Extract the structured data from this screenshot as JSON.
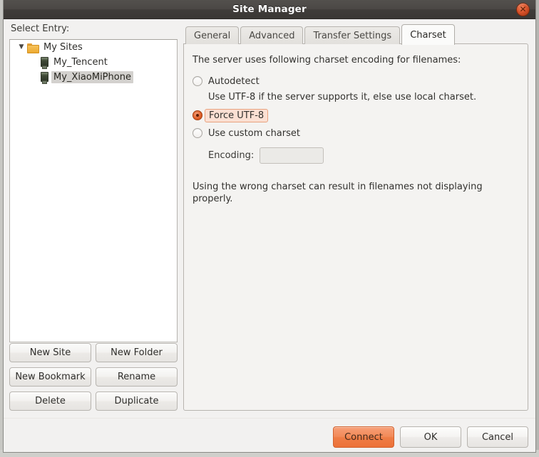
{
  "window": {
    "title": "Site Manager",
    "close_icon": "close-icon",
    "close_glyph": "✕"
  },
  "left_pane": {
    "label": "Select Entry:",
    "tree": [
      {
        "label": "My Sites",
        "icon": "folder-icon",
        "level": 1,
        "expander": "▼",
        "selected": false
      },
      {
        "label": "My_Tencent",
        "icon": "server-icon",
        "level": 2,
        "expander": "",
        "selected": false
      },
      {
        "label": "My_XiaoMiPhone",
        "icon": "server-icon",
        "level": 2,
        "expander": "",
        "selected": true
      }
    ],
    "buttons": [
      "New Site",
      "New Folder",
      "New Bookmark",
      "Rename",
      "Delete",
      "Duplicate"
    ]
  },
  "right_pane": {
    "tabs": [
      {
        "label": "General",
        "active": false
      },
      {
        "label": "Advanced",
        "active": false
      },
      {
        "label": "Transfer Settings",
        "active": false
      },
      {
        "label": "Charset",
        "active": true
      }
    ],
    "charset": {
      "intro": "The server uses following charset encoding for filenames:",
      "options": [
        {
          "label": "Autodetect",
          "checked": false,
          "focused": false
        },
        {
          "label": "Force UTF-8",
          "checked": true,
          "focused": true
        },
        {
          "label": "Use custom charset",
          "checked": false,
          "focused": false
        }
      ],
      "autodetect_hint": "Use UTF-8 if the server supports it, else use local charset.",
      "encoding_label": "Encoding:",
      "encoding_value": "",
      "encoding_placeholder": "",
      "warning": "Using the wrong charset can result in filenames not displaying properly."
    }
  },
  "actions": {
    "connect": "Connect",
    "ok": "OK",
    "cancel": "Cancel"
  },
  "colors": {
    "accent": "#ef7d46",
    "focus_bg": "#fbe0d3",
    "selection": "#d3d1ce",
    "titlebar": "#413e3b"
  }
}
